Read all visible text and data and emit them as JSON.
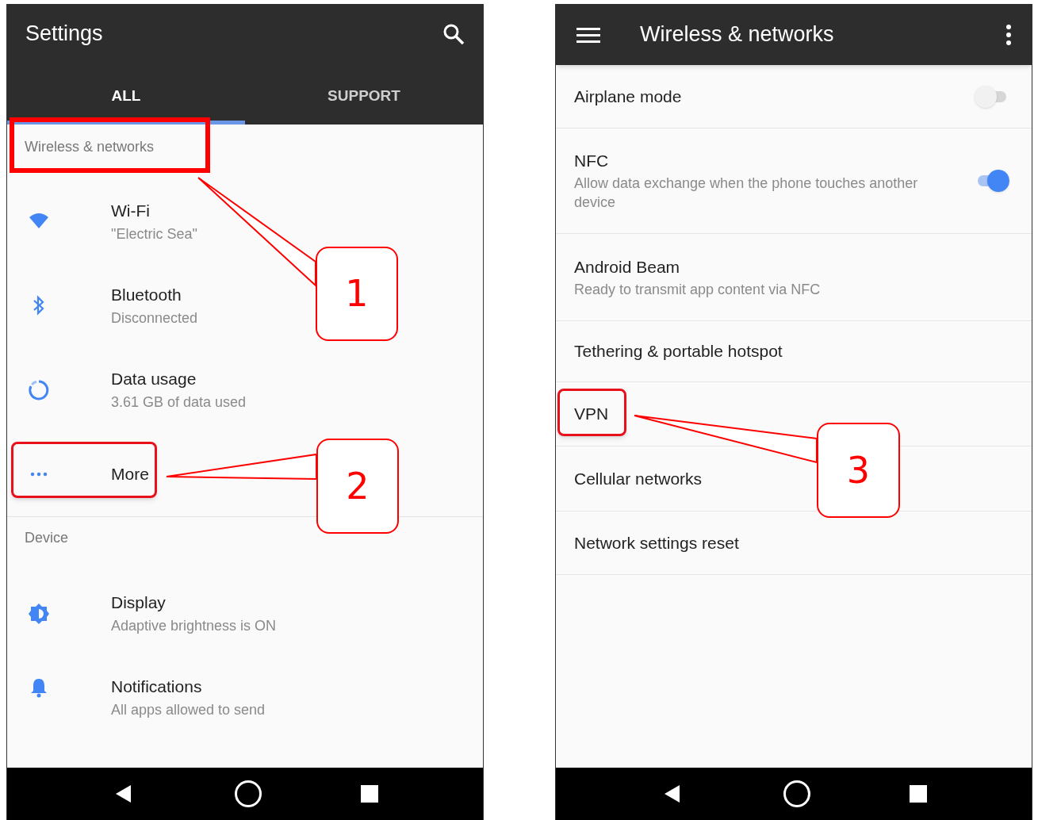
{
  "panels": [
    {
      "kind": "settings",
      "title": "Settings",
      "tabs": [
        {
          "label": "ALL",
          "selected": true
        },
        {
          "label": "SUPPORT",
          "selected": false
        }
      ],
      "sections": [
        {
          "header": "Wireless & networks",
          "items": [
            {
              "kind": "wifi",
              "title": "Wi-Fi",
              "subtitle": "\"Electric Sea\""
            },
            {
              "kind": "bluetooth",
              "title": "Bluetooth",
              "subtitle": "Disconnected"
            },
            {
              "kind": "data",
              "title": "Data usage",
              "subtitle": "3.61 GB of data used"
            },
            {
              "kind": "more",
              "title": "More"
            }
          ]
        },
        {
          "header": "Device",
          "items": [
            {
              "kind": "display",
              "title": "Display",
              "subtitle": "Adaptive brightness is ON"
            },
            {
              "kind": "bell",
              "title": "Notifications",
              "subtitle": "All apps allowed to send"
            }
          ]
        }
      ]
    },
    {
      "kind": "list",
      "title": "Wireless & networks",
      "items": [
        {
          "title": "Airplane mode",
          "on": false
        },
        {
          "title": "NFC",
          "subtitle": "Allow data exchange when the phone touches another device",
          "on": true
        },
        {
          "title": "Android Beam",
          "subtitle": "Ready to transmit app content via NFC"
        },
        {
          "title": "Tethering & portable hotspot"
        },
        {
          "title": "VPN"
        },
        {
          "title": "Cellular networks"
        },
        {
          "title": "Network settings reset"
        }
      ]
    }
  ],
  "callouts": [
    {
      "number": "1"
    },
    {
      "number": "2"
    },
    {
      "number": "3"
    }
  ]
}
